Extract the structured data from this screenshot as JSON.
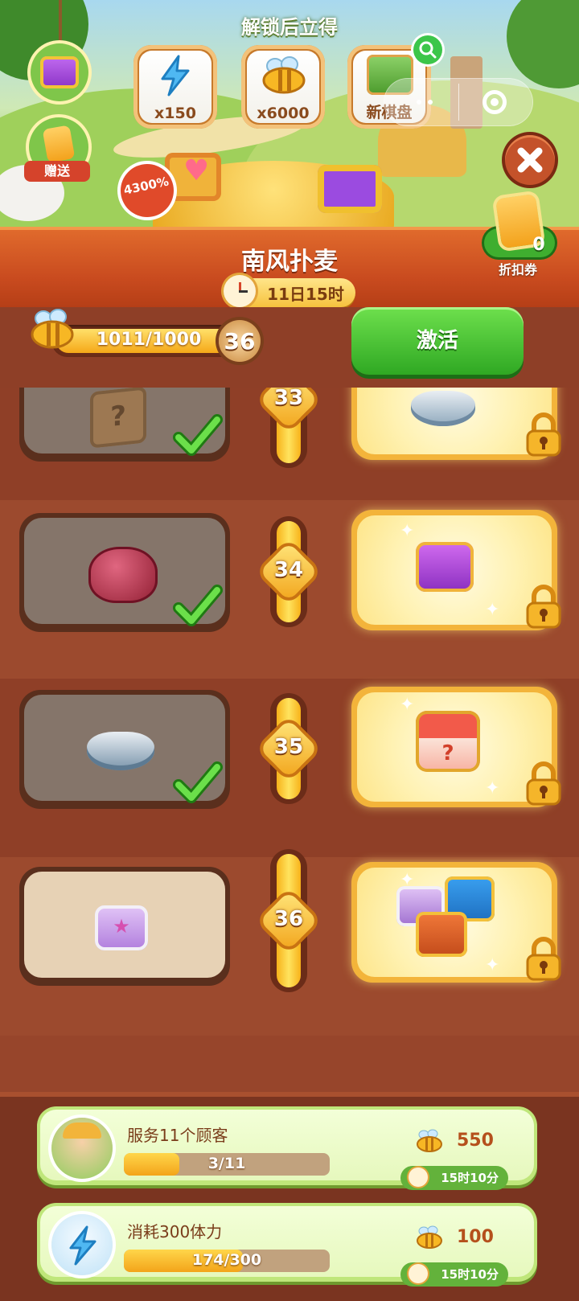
{
  "header": {
    "unlock_title": "解锁后立得",
    "rewards": [
      {
        "label": "x150",
        "icon": "lightning-icon"
      },
      {
        "label": "x6000",
        "icon": "bee-icon"
      },
      {
        "label": "新棋盘",
        "icon": "new-board-icon"
      }
    ],
    "gift_label": "赠送",
    "discount_badge": "4300%",
    "coupon_label": "折扣券",
    "coupon_count": "0"
  },
  "event": {
    "title": "南风扑麦",
    "timer": "11日15时"
  },
  "progress": {
    "text": "1011/1000",
    "fill_fraction": 1.0,
    "level": "36",
    "activate_label": "激活"
  },
  "levels": [
    {
      "level": "33",
      "free_item": "mystery-box-icon",
      "claimed": true,
      "premium_item": "shell-bowl-icon",
      "locked": true
    },
    {
      "level": "34",
      "free_item": "ruby-icon",
      "claimed": true,
      "premium_item": "purple-chest-icon",
      "locked": true
    },
    {
      "level": "35",
      "free_item": "shell-bowl-icon",
      "claimed": true,
      "premium_item": "red-mystery-chest-icon",
      "locked": true
    },
    {
      "level": "36",
      "free_item": "purple-chest-icon",
      "claimed": false,
      "premium_item": "chest-bundle-icon",
      "locked": true
    }
  ],
  "tasks": [
    {
      "title": "服务11个顾客",
      "progress_text": "3/11",
      "fill_fraction": 0.27,
      "reward": "550",
      "timer": "15时10分",
      "icon": "farmer-avatar-icon"
    },
    {
      "title": "消耗300体力",
      "progress_text": "174/300",
      "fill_fraction": 0.58,
      "reward": "100",
      "timer": "15时10分",
      "icon": "lightning-avatar-icon"
    }
  ]
}
